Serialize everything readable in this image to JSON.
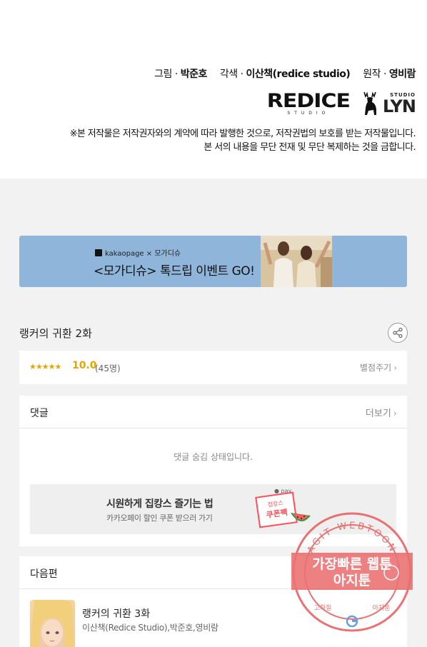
{
  "credits": {
    "art_label": "그림 · ",
    "art_name": "박준호",
    "adapt_label": "각색 · ",
    "adapt_name": "이산책(redice studio)",
    "original_label": "원작 · ",
    "original_name": "영비람",
    "logo_redice": "REDICE",
    "logo_studio": "STUDIO",
    "logo_lyn": "LYN",
    "copyright_line1": "※본 저작물은 저작권자와의 계약에 따라 발행한 것으로, 저작권법의 보호를 받는 저작물입니다.",
    "copyright_line2": "본 서의 내용을 무단 전재 및 무단 복제하는 것을 금합니다."
  },
  "banner": {
    "brand": "kakaopage × 모가디슈",
    "text": "<모가디슈> 톡드립 이벤트 GO!",
    "bg_color": "#8fb6da"
  },
  "episode": {
    "title": "랭커의 귀환 2화",
    "share_icon": "share-icon"
  },
  "rating": {
    "stars": "★★★★★",
    "score": "10.0",
    "count": "(45명)",
    "rate_link": "별점주기",
    "accent_color": "#e6a400"
  },
  "comments": {
    "title": "댓글",
    "more": "더보기",
    "hidden_message": "댓글 숨김 상태입니다.",
    "promo_title": "시원하게 집캉스 즐기는 법",
    "promo_sub": "카카오페이 할인 쿠폰 받으러 가기",
    "promo_pay": "● pay",
    "promo_badge_top": "집캉스",
    "promo_badge_main": "쿠폰팩"
  },
  "next": {
    "title": "다음편",
    "episode_title": "랭커의 귀환 3화",
    "authors": "이산책(Redice Studio),박준호,영비람"
  },
  "watermark": {
    "ring_text": "AGIT WEBTOON",
    "line1": "가장빠른 웹툰",
    "line2": "아지툰",
    "bottom_left": "고화질",
    "bottom_right": "아지툰",
    "color": "#e85a5a"
  }
}
